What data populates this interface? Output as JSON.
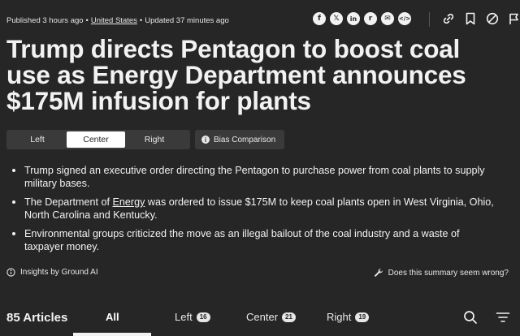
{
  "meta": {
    "published": "Published 3 hours ago",
    "sep1": "•",
    "section": "United States",
    "sep2": "•",
    "updated": "Updated 37 minutes ago"
  },
  "share_icons": [
    {
      "name": "facebook-icon",
      "glyph": "f"
    },
    {
      "name": "x-icon",
      "glyph": "𝕏"
    },
    {
      "name": "linkedin-icon",
      "glyph": "in"
    },
    {
      "name": "reddit-icon",
      "glyph": "r"
    },
    {
      "name": "email-icon",
      "glyph": "✉"
    },
    {
      "name": "embed-icon",
      "glyph": "</>"
    }
  ],
  "headline": "Trump directs Pentagon to boost coal use as Energy Department announces $175M infusion for plants",
  "bias_toggle": {
    "left": "Left",
    "center": "Center",
    "right": "Right",
    "selected": "Center"
  },
  "bias_comparison": "Bias Comparison",
  "summary": {
    "b1": "Trump signed an executive order directing the Pentagon to purchase power from coal plants to supply military bases.",
    "b2_pre": "The Department of ",
    "b2_link": "Energy",
    "b2_post": " was ordered to issue $175M to keep coal plants open in West Virginia, Ohio, North Carolina and Kentucky.",
    "b3": "Environmental groups criticized the move as an illegal bailout of the coal industry and a waste of taxpayer money."
  },
  "insights": "Insights by Ground AI",
  "feedback": "Does this summary seem wrong?",
  "articles": {
    "count_label": "85 Articles",
    "tabs": {
      "all": "All",
      "left": "Left",
      "left_count": "16",
      "center": "Center",
      "center_count": "21",
      "right": "Right",
      "right_count": "19"
    }
  },
  "colors": {
    "background": "#262626",
    "text": "#f2f2f2",
    "segment_bg": "#3a3a3a",
    "segment_active": "#ffffff"
  }
}
